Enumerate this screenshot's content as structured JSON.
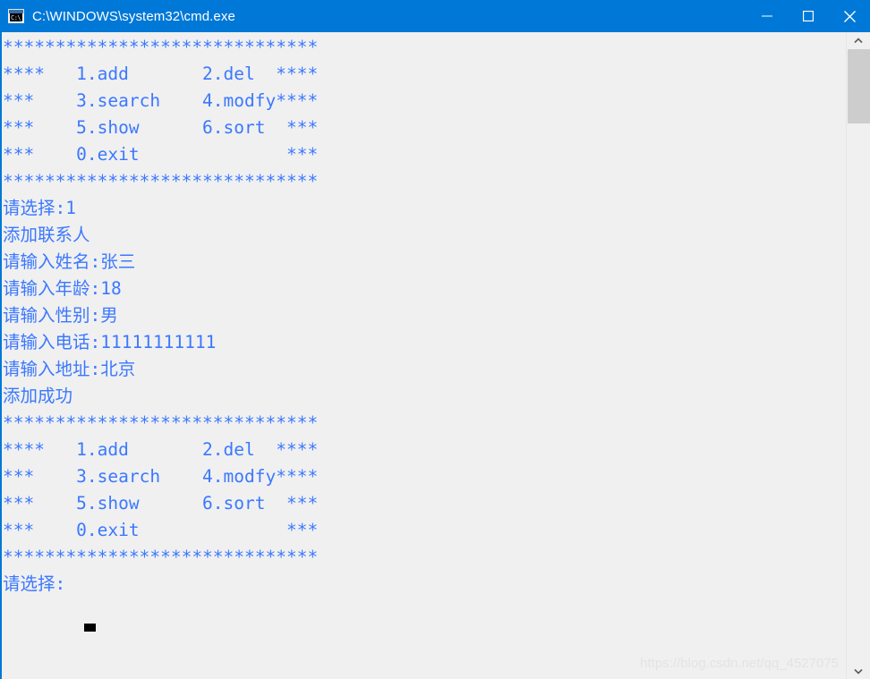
{
  "window": {
    "title": "C:\\WINDOWS\\system32\\cmd.exe",
    "icon_name": "cmd-exe-icon",
    "icon_glyph": "C:\\_",
    "accent_color": "#0078d7",
    "background_color": "#f0f0f0",
    "text_color": "#3b78ff"
  },
  "titlebar": {
    "minimize_label": "Minimize",
    "maximize_label": "Maximize",
    "close_label": "Close"
  },
  "console": {
    "lines": [
      "******************************",
      "****   1.add       2.del  ****",
      "***    3.search    4.modfy****",
      "***    5.show      6.sort  ***",
      "***    0.exit              ***",
      "******************************",
      "请选择:1",
      "添加联系人",
      "请输入姓名:张三",
      "请输入年龄:18",
      "请输入性别:男",
      "请输入电话:11111111111",
      "请输入地址:北京",
      "添加成功",
      "******************************",
      "****   1.add       2.del  ****",
      "***    3.search    4.modfy****",
      "***    5.show      6.sort  ***",
      "***    0.exit              ***",
      "******************************",
      "请选择:"
    ],
    "menu_options": [
      {
        "key": "1",
        "label": "add"
      },
      {
        "key": "2",
        "label": "del"
      },
      {
        "key": "3",
        "label": "search"
      },
      {
        "key": "4",
        "label": "modfy"
      },
      {
        "key": "5",
        "label": "show"
      },
      {
        "key": "6",
        "label": "sort"
      },
      {
        "key": "0",
        "label": "exit"
      }
    ],
    "prompts": {
      "choose": "请选择:",
      "add_contact": "添加联系人",
      "name": "请输入姓名:",
      "age": "请输入年龄:",
      "gender": "请输入性别:",
      "phone": "请输入电话:",
      "address": "请输入地址:",
      "success": "添加成功"
    },
    "entered_values": {
      "first_choice": "1",
      "name": "张三",
      "age": "18",
      "gender": "男",
      "phone": "11111111111",
      "address": "北京"
    },
    "cursor": "block"
  },
  "watermark": {
    "text": "https://blog.csdn.net/qq_4527075"
  },
  "scrollbar": {
    "up_arrow": "▲",
    "down_arrow": "▼",
    "thumb_color": "#cdcdcd",
    "track_color": "#f0f0f0"
  }
}
